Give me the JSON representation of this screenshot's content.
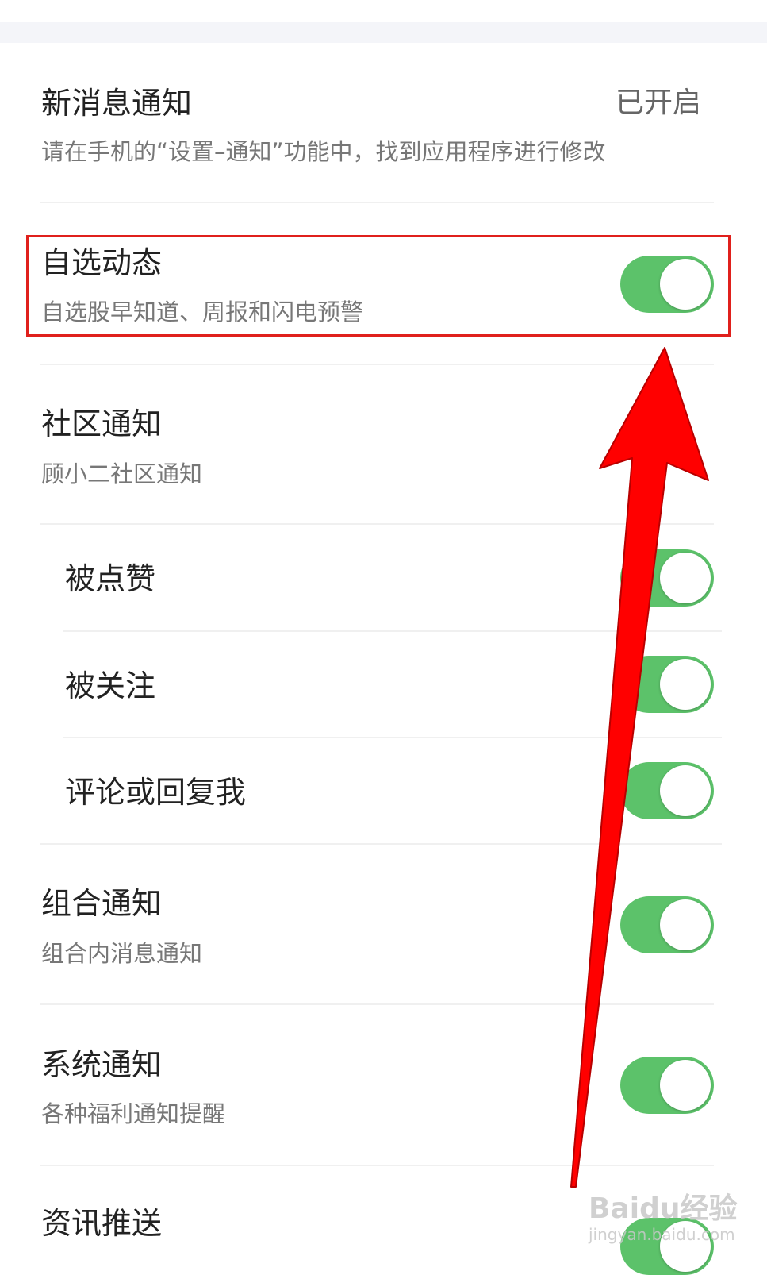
{
  "settings": {
    "new_message": {
      "title": "新消息通知",
      "status": "已开启",
      "description": "请在手机的“设置–通知”功能中，找到应用程序进行修改"
    },
    "watchlist": {
      "title": "自选动态",
      "description": "自选股早知道、周报和闪电预警",
      "enabled": true
    },
    "community": {
      "title": "社区通知",
      "description": "顾小二社区通知",
      "items": [
        {
          "label": "被点赞",
          "enabled": true
        },
        {
          "label": "被关注",
          "enabled": true
        },
        {
          "label": "评论或回复我",
          "enabled": true
        }
      ]
    },
    "portfolio": {
      "title": "组合通知",
      "description": "组合内消息通知",
      "enabled": true
    },
    "system": {
      "title": "系统通知",
      "description": "各种福利通知提醒",
      "enabled": true
    },
    "news_push": {
      "title": "资讯推送",
      "enabled": true
    }
  },
  "watermark": {
    "main": "Baidu经验",
    "sub": "jingyan.baidu.com"
  },
  "colors": {
    "toggle_on": "#5cc26a",
    "highlight": "#e0201c",
    "arrow": "#ff0000"
  }
}
